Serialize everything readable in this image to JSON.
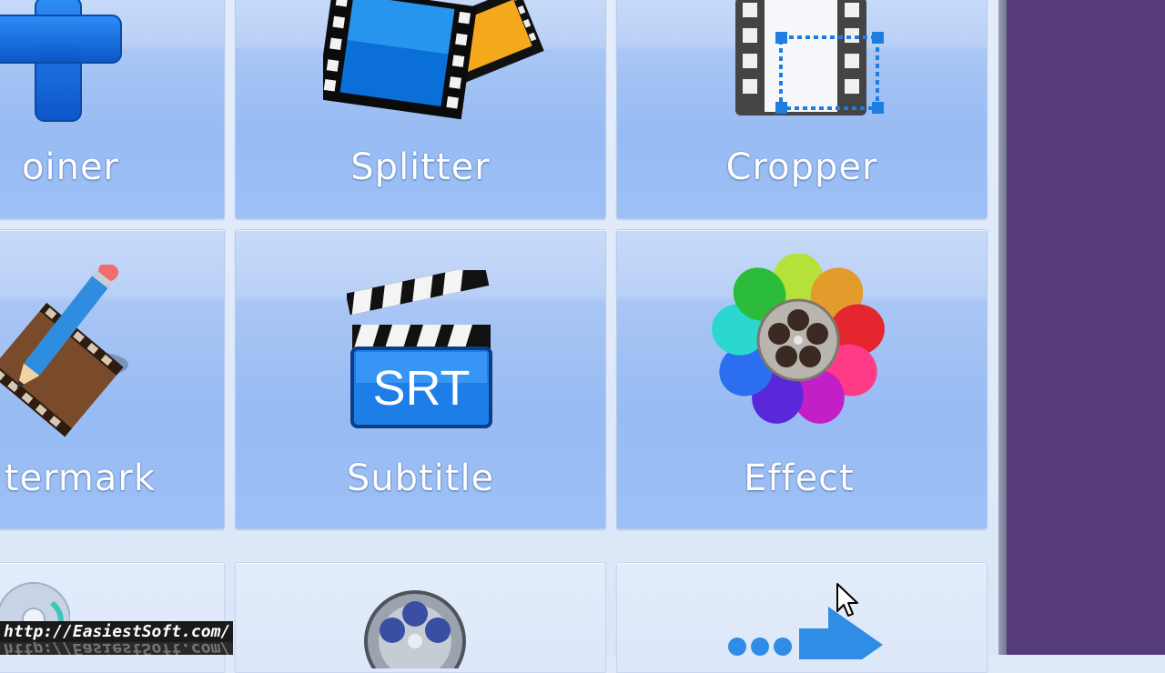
{
  "tools": {
    "joiner": {
      "label": "oiner"
    },
    "splitter": {
      "label": "Splitter"
    },
    "cropper": {
      "label": "Cropper"
    },
    "watermark": {
      "label": "termark"
    },
    "subtitle": {
      "label": "Subtitle",
      "icon_text": "SRT"
    },
    "effect": {
      "label": "Effect"
    }
  },
  "icons": {
    "joiner": "plus-icon",
    "splitter": "film-split-icon",
    "cropper": "film-crop-icon",
    "watermark": "film-pencil-icon",
    "subtitle": "clapperboard-srt-icon",
    "effect": "color-flower-reel-icon",
    "row3_left": "disc-icon",
    "row3_mid": "film-reel-icon",
    "row3_right": "arrow-right-icon"
  },
  "watermark_text": "http://EasiestSoft.com/",
  "colors": {
    "tile_blue": "#a9c6f5",
    "label_white": "#ffffff",
    "side_purple": "#553b7b",
    "icon_blue": "#1a6fe0"
  }
}
